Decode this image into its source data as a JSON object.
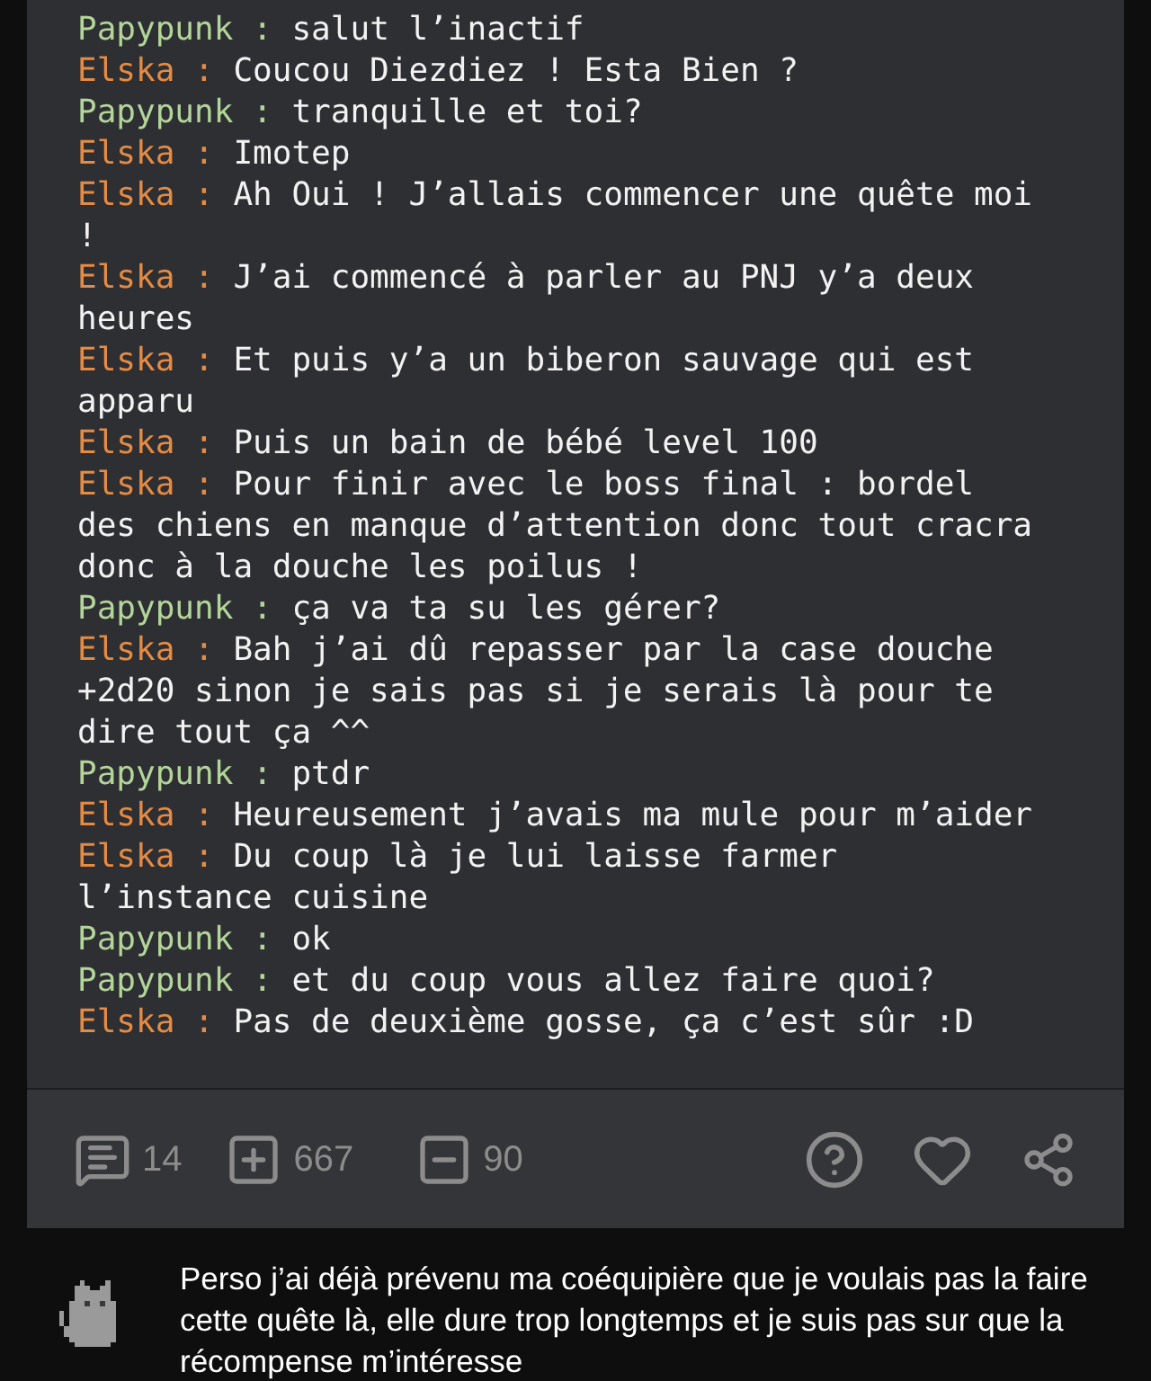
{
  "messages": [
    {
      "author": "Papypunk :",
      "color": "#b3d59a",
      "text": "salut l’inactif"
    },
    {
      "author": "Elska :",
      "color": "#e58b43",
      "text": "Coucou Diezdiez ! Esta Bien ?"
    },
    {
      "author": "Papypunk :",
      "color": "#b3d59a",
      "text": "tranquille et toi?"
    },
    {
      "author": "Elska :",
      "color": "#e58b43",
      "text": "Imotep"
    },
    {
      "author": "Elska :",
      "color": "#e58b43",
      "text": "Ah Oui ! J’allais commencer une quête moi !"
    },
    {
      "author": "Elska :",
      "color": "#e58b43",
      "text": "J’ai commencé à parler au PNJ y’a deux heures"
    },
    {
      "author": "Elska :",
      "color": "#e58b43",
      "text": "Et puis y’a un biberon sauvage qui est apparu"
    },
    {
      "author": "Elska :",
      "color": "#e58b43",
      "text": "Puis un bain de bébé level 100"
    },
    {
      "author": "Elska :",
      "color": "#e58b43",
      "text": "Pour finir avec le boss final : bordel des chiens en manque d’attention donc tout cracra donc à la douche les poilus !"
    },
    {
      "author": "Papypunk :",
      "color": "#b3d59a",
      "text": "ça va ta su les gérer?"
    },
    {
      "author": "Elska :",
      "color": "#e58b43",
      "text": "Bah j’ai dû repasser par la case douche +2d20 sinon je sais pas si je serais là pour te dire tout ça ^^"
    },
    {
      "author": "Papypunk :",
      "color": "#b3d59a",
      "text": "ptdr"
    },
    {
      "author": "Elska :",
      "color": "#e58b43",
      "text": "Heureusement j’avais ma mule pour m’aider"
    },
    {
      "author": "Elska :",
      "color": "#e58b43",
      "text": "Du coup là je lui laisse farmer l’instance cuisine"
    },
    {
      "author": "Papypunk :",
      "color": "#b3d59a",
      "text": "ok"
    },
    {
      "author": "Papypunk :",
      "color": "#b3d59a",
      "text": "et du coup vous allez faire quoi?"
    },
    {
      "author": "Elska :",
      "color": "#e58b43",
      "text": "Pas de deuxième gosse, ça c’est sûr :D"
    }
  ],
  "actions": {
    "comments": "14",
    "upvotes": "667",
    "downvotes": "90"
  },
  "comment": {
    "text": "Perso j’ai déjà prévenu ma coéquipière que je voulais pas la faire cette quête là, elle dure trop longtemps et je suis pas sur que la récompense m’intéresse"
  }
}
